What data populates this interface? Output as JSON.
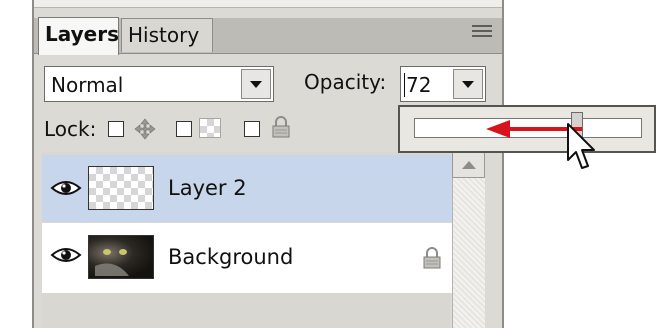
{
  "tabs": [
    {
      "label": "Layers",
      "active": true
    },
    {
      "label": "History",
      "active": false
    }
  ],
  "blend_mode": {
    "value": "Normal"
  },
  "opacity": {
    "label": "Opacity:",
    "value": "72"
  },
  "lock": {
    "label": "Lock:",
    "icons": [
      "move-icon",
      "transparency-lock-icon",
      "lock-icon"
    ]
  },
  "slider": {
    "level_percent": 72
  },
  "layers": [
    {
      "name": "Layer 2",
      "selected": true,
      "visible": true,
      "locked": false
    },
    {
      "name": "Background",
      "selected": false,
      "visible": true,
      "locked": true
    }
  ],
  "colors": {
    "selection": "#c7d6ea",
    "panel": "#dcdad5",
    "arrow": "#d7141b"
  }
}
